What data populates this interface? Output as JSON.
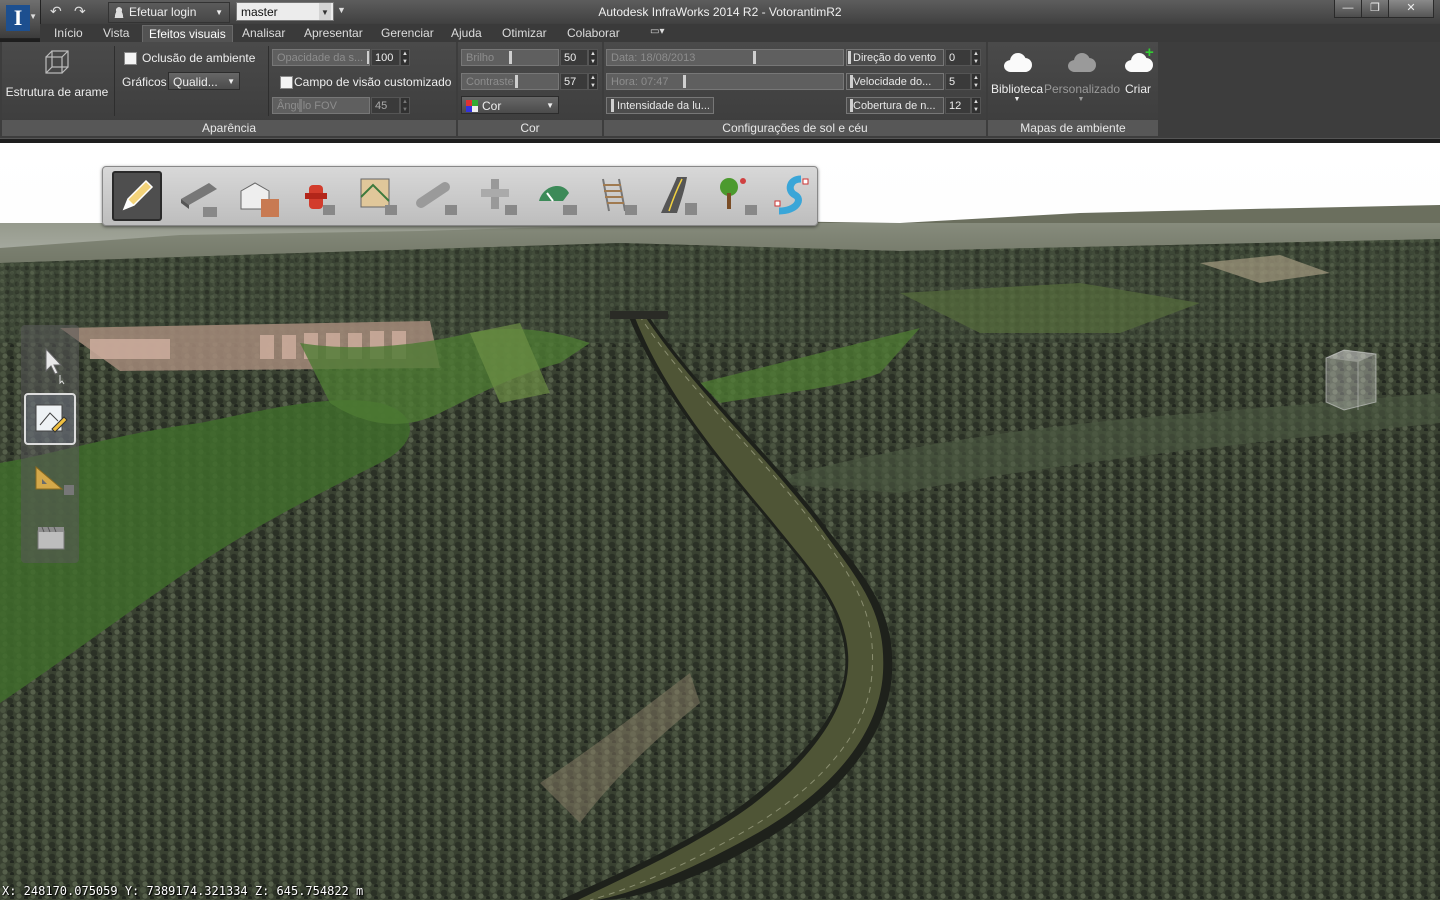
{
  "window": {
    "title": "Autodesk InfraWorks 2014 R2 - VotorantimR2",
    "minimize": "—",
    "maximize": "❐",
    "close": "✕"
  },
  "quick_access": {
    "app_logo": "I",
    "undo_icon": "↶",
    "redo_icon": "↷",
    "login_label": "Efetuar login",
    "branch_value": "master"
  },
  "tabs": [
    {
      "label": "Início"
    },
    {
      "label": "Vista"
    },
    {
      "label": "Efeitos visuais",
      "active": true
    },
    {
      "label": "Analisar"
    },
    {
      "label": "Apresentar"
    },
    {
      "label": "Gerenciar"
    },
    {
      "label": "Ajuda"
    },
    {
      "label": "Otimizar"
    },
    {
      "label": "Colaborar"
    }
  ],
  "ribbon": {
    "wireframe_label": "Estrutura de arame",
    "panel_appearance": {
      "title": "Aparência",
      "ambient_occlusion_label": "Oclusão de ambiente",
      "ambient_occlusion_checked": false,
      "graphics_label": "Gráficos",
      "graphics_value": "Qualid...",
      "custom_fov_label": "Campo de visão customizado",
      "custom_fov_checked": false,
      "opacity_placeholder": "Opacidade da s...",
      "opacity_value": "100",
      "fov_angle_placeholder": "Ângulo FOV",
      "fov_angle_value": "45"
    },
    "panel_color": {
      "title": "Cor",
      "brightness_placeholder": "Brilho",
      "brightness_value": "50",
      "contrast_placeholder": "Contraste",
      "contrast_value": "57",
      "color_mode": "Cor"
    },
    "panel_sun_sky": {
      "title": "Configurações de sol e céu",
      "date_placeholder": "Data: 18/08/2013",
      "time_placeholder": "Hora: 07:47",
      "light_intensity_label": "Intensidade da lu...",
      "wind_direction_label": "Direção do vento",
      "wind_direction_value": "0",
      "wind_speed_label": "Velocidade do...",
      "wind_speed_value": "5",
      "cloud_cover_label": "Cobertura de n...",
      "cloud_cover_value": "12"
    },
    "panel_environment_maps": {
      "title": "Mapas de ambiente",
      "library_label": "Biblioteca",
      "custom_label": "Personalizado",
      "create_label": "Criar"
    }
  },
  "create_toolbar": {
    "tools": [
      "pencil-icon",
      "road-icon",
      "building-icon",
      "hydrant-icon",
      "coverage-area-icon",
      "pipe-icon",
      "pipeline-connector-icon",
      "terrain-theme-icon",
      "railway-icon",
      "highway-icon",
      "tree-icon",
      "water-area-icon"
    ],
    "selected": "pencil-icon"
  },
  "nav_toolbar": {
    "tools": [
      "select-icon",
      "edit-area-icon",
      "measure-icon",
      "storyboard-icon"
    ],
    "selected": "edit-area-icon"
  },
  "status": {
    "coordinates": "X: 248170.075059 Y: 7389174.321334 Z: 645.754822 m"
  }
}
